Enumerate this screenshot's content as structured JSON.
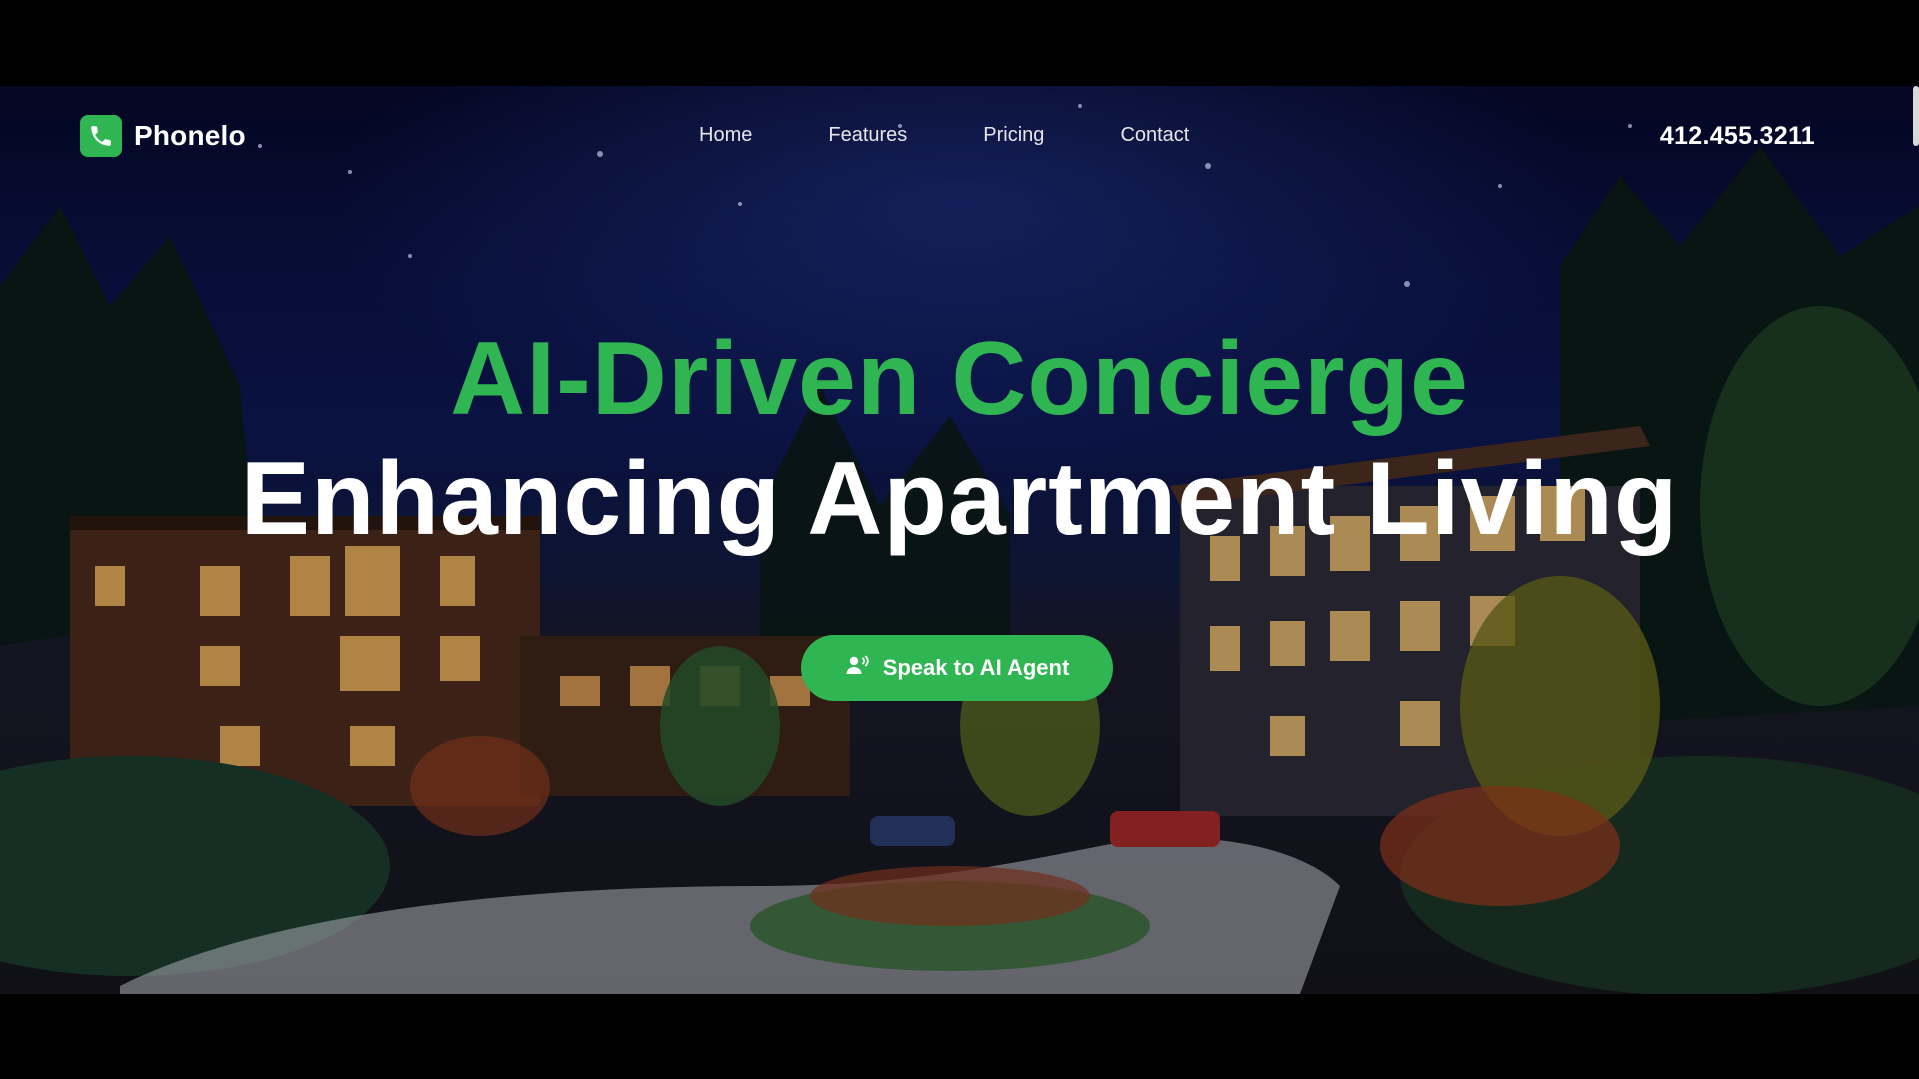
{
  "brand": {
    "name": "Phonelo",
    "logo_icon": "phone-icon",
    "accent": "#2fb552"
  },
  "nav": {
    "items": [
      {
        "label": "Home"
      },
      {
        "label": "Features"
      },
      {
        "label": "Pricing"
      },
      {
        "label": "Contact"
      }
    ],
    "phone": "412.455.3211"
  },
  "hero": {
    "headline_line1": "AI-Driven Concierge",
    "headline_line2": "Enhancing Apartment Living",
    "cta_label": "Speak to AI Agent",
    "cta_icon": "user-voice-icon",
    "background": "night-time-apartment-complex-illustration"
  }
}
